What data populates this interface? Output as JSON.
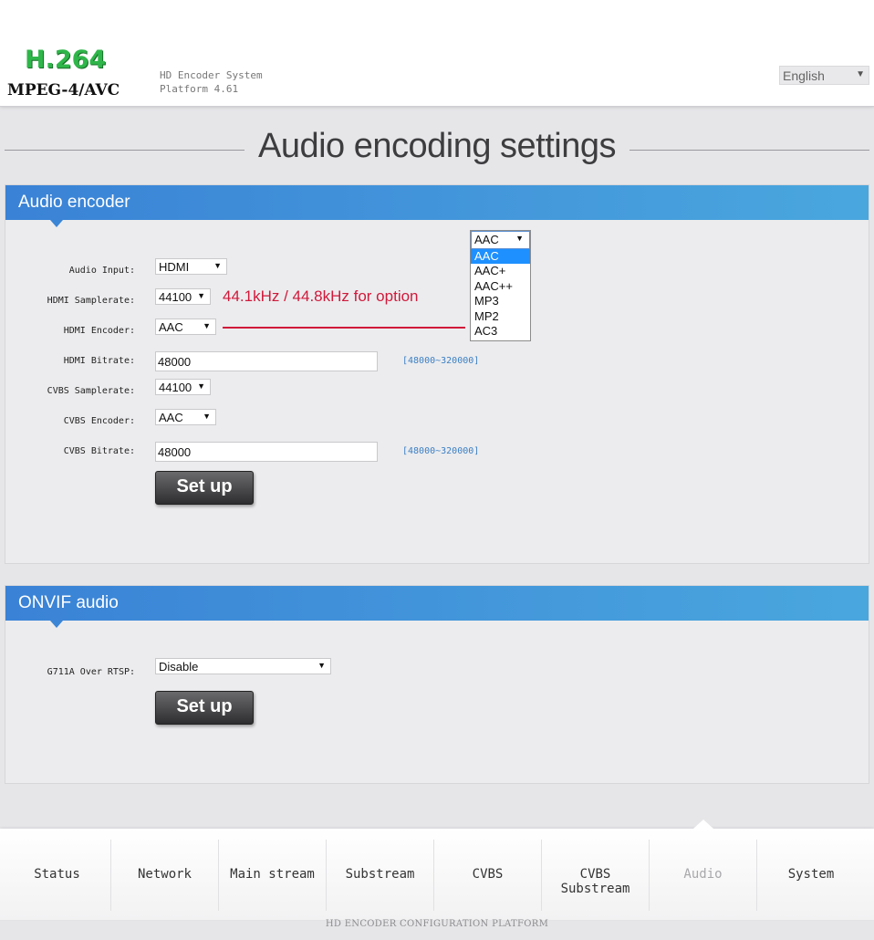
{
  "header": {
    "logo_line1": "H.264",
    "logo_line2": "MPEG-4/AVC",
    "system_name": "HD Encoder System",
    "platform_version": "Platform 4.61",
    "language": "English"
  },
  "page_title": "Audio encoding settings",
  "audio_encoder": {
    "title": "Audio encoder",
    "fields": {
      "audio_input_label": "Audio Input:",
      "audio_input_value": "HDMI",
      "hdmi_samplerate_label": "HDMI Samplerate:",
      "hdmi_samplerate_value": "44100",
      "hdmi_encoder_label": "HDMI Encoder:",
      "hdmi_encoder_value": "AAC",
      "hdmi_bitrate_label": "HDMI Bitrate:",
      "hdmi_bitrate_value": "48000",
      "hdmi_bitrate_range": "[48000~320000]",
      "cvbs_samplerate_label": "CVBS Samplerate:",
      "cvbs_samplerate_value": "44100",
      "cvbs_encoder_label": "CVBS Encoder:",
      "cvbs_encoder_value": "AAC",
      "cvbs_bitrate_label": "CVBS Bitrate:",
      "cvbs_bitrate_value": "48000",
      "cvbs_bitrate_range": "[48000~320000]"
    },
    "setup_label": "Set up",
    "annotation": "44.1kHz / 44.8kHz for option"
  },
  "encoder_dropdown": {
    "selected": "AAC",
    "options": [
      "AAC",
      "AAC+",
      "AAC++",
      "MP3",
      "MP2",
      "AC3"
    ]
  },
  "onvif_audio": {
    "title": "ONVIF audio",
    "g711a_label": "G711A Over RTSP:",
    "g711a_value": "Disable",
    "setup_label": "Set up"
  },
  "nav": {
    "items": [
      "Status",
      "Network",
      "Main stream",
      "Substream",
      "CVBS",
      "CVBS Substream",
      "Audio",
      "System"
    ],
    "active": "Audio"
  },
  "footer": "HD ENCODER CONFIGURATION PLATFORM",
  "colors": {
    "panel_header_start": "#3a82d6",
    "panel_header_end": "#4aa7de",
    "annotation_red": "#d0193a",
    "logo_green": "#2fb64a",
    "range_blue": "#3b7fc4"
  }
}
